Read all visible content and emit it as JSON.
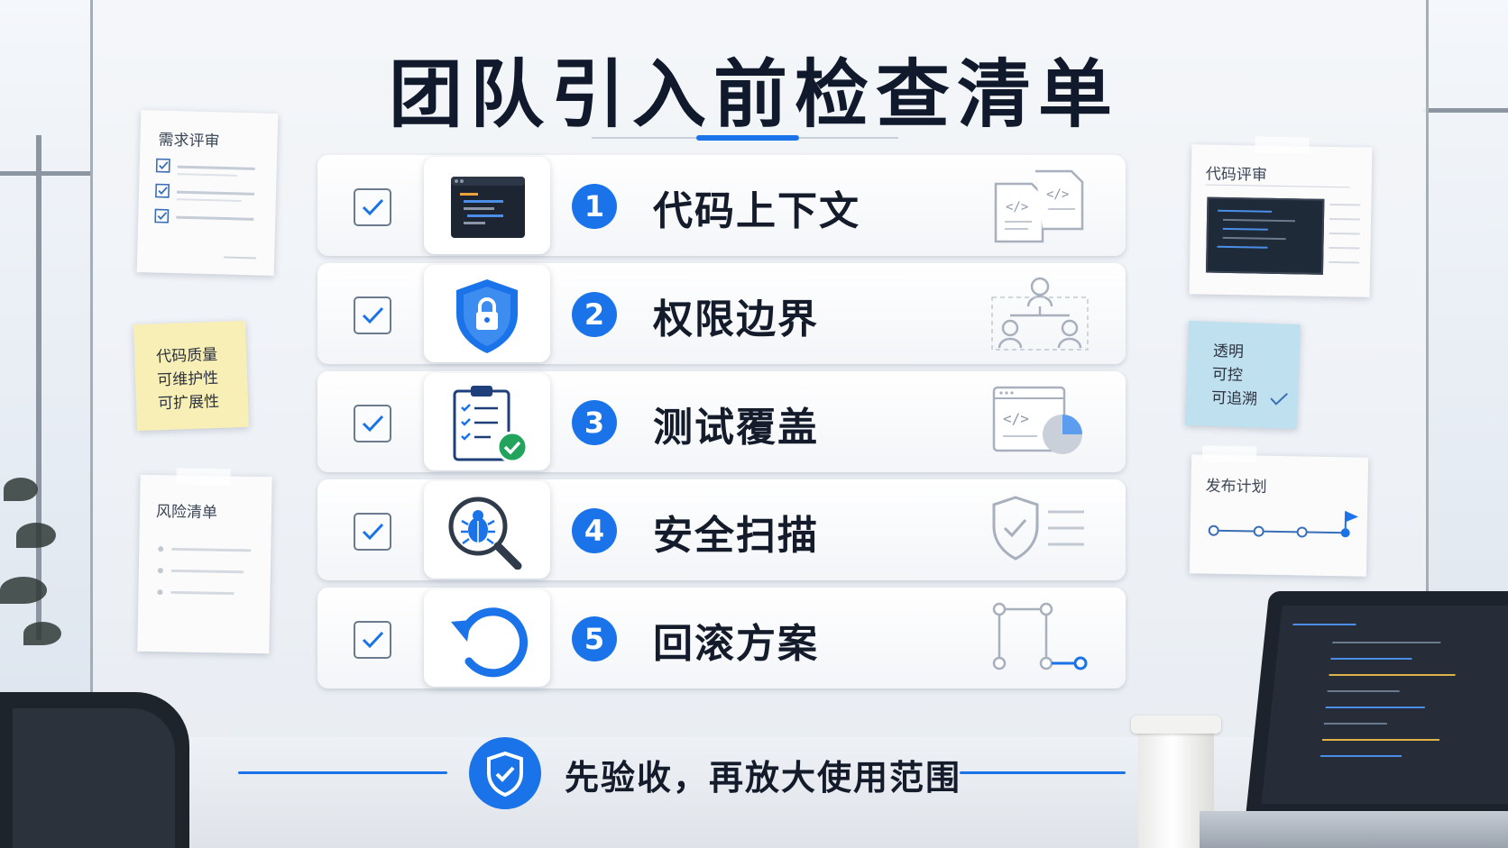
{
  "title": "团队引入前检查清单",
  "checklist": [
    {
      "number": "1",
      "label": "代码上下文",
      "icon": "code-editor-icon",
      "side_icon": "code-files-icon",
      "checked": true
    },
    {
      "number": "2",
      "label": "权限边界",
      "icon": "shield-lock-icon",
      "side_icon": "org-chart-icon",
      "checked": true
    },
    {
      "number": "3",
      "label": "测试覆盖",
      "icon": "clipboard-check-icon",
      "side_icon": "code-coverage-chart-icon",
      "checked": true
    },
    {
      "number": "4",
      "label": "安全扫描",
      "icon": "bug-magnifier-icon",
      "side_icon": "shield-list-icon",
      "checked": true
    },
    {
      "number": "5",
      "label": "回滚方案",
      "icon": "rollback-arrow-icon",
      "side_icon": "flow-path-icon",
      "checked": true
    }
  ],
  "notes": {
    "requirements_review": "需求评审",
    "code_quality": [
      "代码质量",
      "可维护性",
      "可扩展性"
    ],
    "risk_list": "风险清单",
    "code_review": "代码评审",
    "principles": [
      "透明",
      "可控",
      "可追溯"
    ],
    "release_plan": "发布计划"
  },
  "footer": "先验收，再放大使用范围",
  "colors": {
    "accent": "#1a73e8",
    "text": "#141c2c",
    "sticky_yellow": "#f8efb6",
    "sticky_blue": "#bfe0ef"
  }
}
